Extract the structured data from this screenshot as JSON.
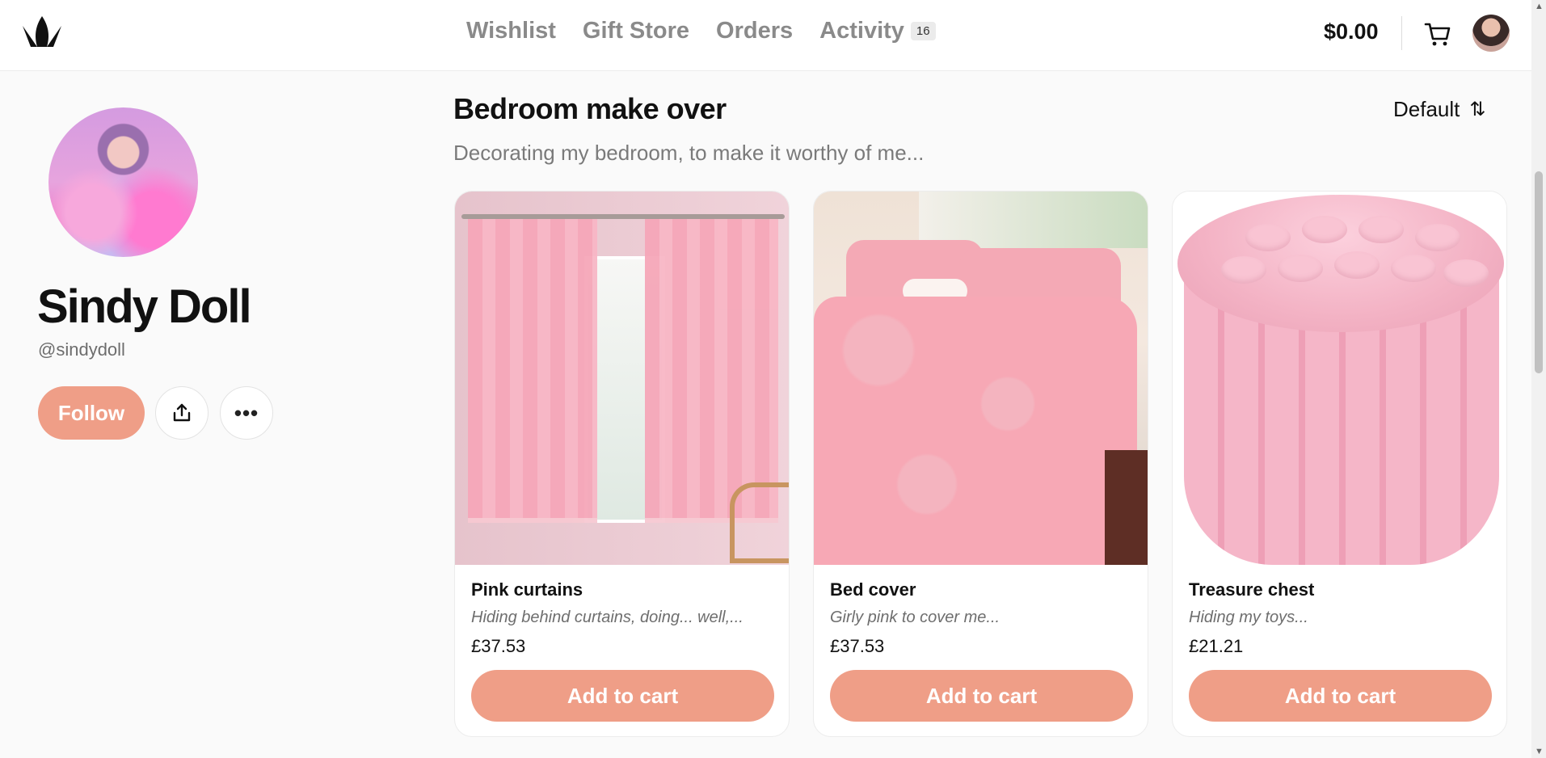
{
  "header": {
    "nav": [
      {
        "label": "Wishlist"
      },
      {
        "label": "Gift Store"
      },
      {
        "label": "Orders"
      },
      {
        "label": "Activity",
        "badge": "16"
      }
    ],
    "balance": "$0.00",
    "icons": {
      "logo": "crown-logo-icon",
      "cart": "cart-icon",
      "avatar": "user-avatar"
    }
  },
  "profile": {
    "name": "Sindy Doll",
    "handle": "@sindydoll",
    "follow_label": "Follow",
    "share_icon": "share-icon",
    "more_icon": "more-icon",
    "more_glyph": "•••"
  },
  "wishlist": {
    "title": "Bedroom make over",
    "description": "Decorating my bedroom, to make it worthy of me...",
    "sort_label": "Default",
    "sort_icon": "sort-arrows-icon",
    "items": [
      {
        "title": "Pink curtains",
        "description": "Hiding behind curtains, doing... well,...",
        "price": "£37.53",
        "button": "Add to cart"
      },
      {
        "title": "Bed cover",
        "description": "Girly pink to cover me...",
        "price": "£37.53",
        "button": "Add to cart"
      },
      {
        "title": "Treasure chest",
        "description": "Hiding my toys...",
        "price": "£21.21",
        "button": "Add to cart"
      }
    ]
  },
  "colors": {
    "accent": "#ef9e87",
    "muted_text": "#8a8a8a"
  }
}
